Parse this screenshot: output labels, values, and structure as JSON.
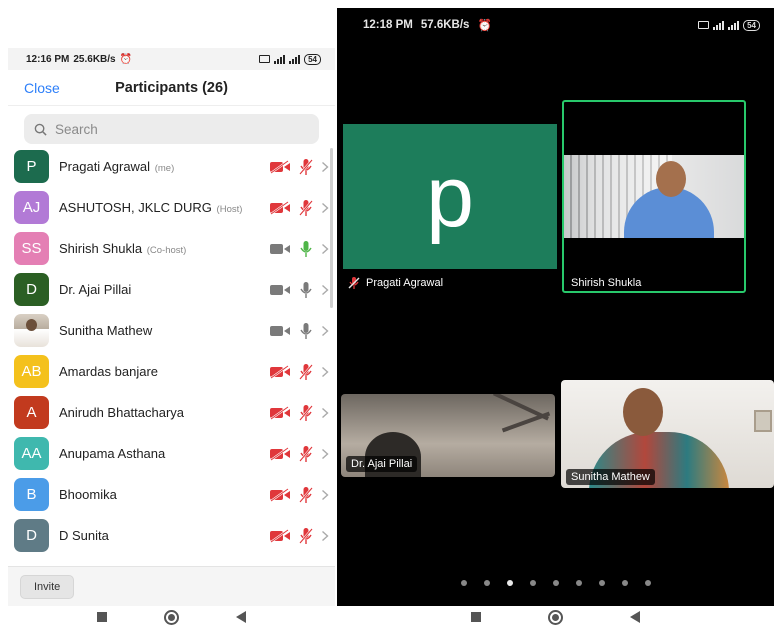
{
  "left": {
    "status": {
      "time": "12:16 PM",
      "speed": "25.6KB/s",
      "battery": "54"
    },
    "header": {
      "close": "Close",
      "title": "Participants (26)"
    },
    "search": {
      "placeholder": "Search"
    },
    "participants": [
      {
        "initials": "P",
        "name": "Pragati Agrawal",
        "tag": "(me)",
        "color": "#1c6b4e",
        "video": "off",
        "audio": "muted"
      },
      {
        "initials": "AJ",
        "name": "ASHUTOSH, JKLC DURG",
        "tag": "(Host)",
        "color": "#b27ad6",
        "video": "off",
        "audio": "muted"
      },
      {
        "initials": "SS",
        "name": "Shirish Shukla",
        "tag": "(Co-host)",
        "color": "#e47fb4",
        "video": "on",
        "audio": "active"
      },
      {
        "initials": "D",
        "name": "Dr. Ajai Pillai",
        "tag": "",
        "color": "#2b5f24",
        "video": "on",
        "audio": "on"
      },
      {
        "initials": "",
        "name": "Sunitha Mathew",
        "tag": "",
        "color": "photo",
        "video": "on",
        "audio": "on"
      },
      {
        "initials": "AB",
        "name": "Amardas banjare",
        "tag": "",
        "color": "#f4c11c",
        "video": "off",
        "audio": "muted"
      },
      {
        "initials": "A",
        "name": "Anirudh Bhattacharya",
        "tag": "",
        "color": "#c23a1e",
        "video": "off",
        "audio": "muted"
      },
      {
        "initials": "AA",
        "name": "Anupama Asthana",
        "tag": "",
        "color": "#3fb8ae",
        "video": "off",
        "audio": "muted"
      },
      {
        "initials": "B",
        "name": "Bhoomika",
        "tag": "",
        "color": "#4b9ce8",
        "video": "off",
        "audio": "muted"
      },
      {
        "initials": "D",
        "name": "D Sunita",
        "tag": "",
        "color": "#5f7b86",
        "video": "off",
        "audio": "muted"
      }
    ],
    "invite": "Invite"
  },
  "right": {
    "status": {
      "time": "12:18 PM",
      "speed": "57.6KB/s",
      "battery": "54"
    },
    "tiles": {
      "pragati": {
        "letter": "P",
        "label": "Pragati Agrawal"
      },
      "shirish": {
        "label": "Shirish Shukla"
      },
      "ajai": {
        "label": "Dr. Ajai Pillai"
      },
      "sunitha": {
        "label": "Sunitha Mathew"
      }
    },
    "page_dots": {
      "count": 9,
      "active": 3
    }
  },
  "colors": {
    "accent": "#2d7ff9",
    "muted_red": "#e0373b",
    "active_green": "#28c96b",
    "tile_green": "#1d7d5b"
  }
}
